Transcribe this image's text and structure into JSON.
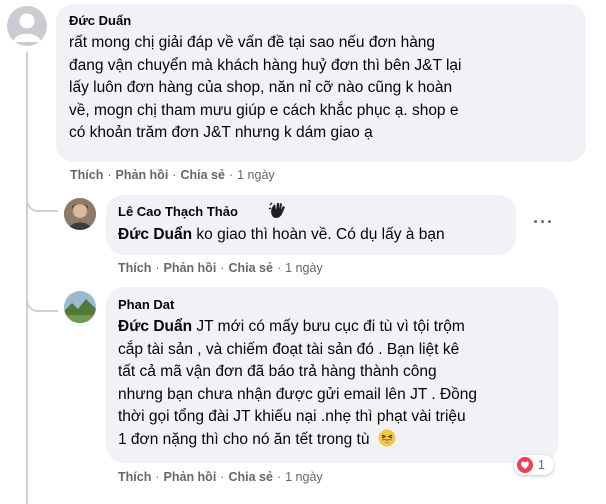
{
  "actions": {
    "like": "Thích",
    "reply": "Phản hồi",
    "share": "Chia sẻ",
    "separator": "·"
  },
  "comments": [
    {
      "author": "Đức Duẩn",
      "lines": [
        "rất mong chị giải đáp về vấn đề tại sao nếu đơn hàng",
        "đang vận chuyển mà khách hàng huỷ đơn thì bên J&T lại",
        "lấy luôn đơn hàng của shop, năn nỉ cỡ nào cũng k hoàn",
        "về, mogn chị tham mưu giúp e cách khắc phục ạ. shop e",
        "có khoản trăm đơn J&T nhưng k dám giao ạ"
      ],
      "time": "1 ngày"
    },
    {
      "author": "Lê Cao Thạch Thảo",
      "mention": "Đức Duẩn",
      "text": " ko giao thì hoàn về. Có dụ lấy à bạn",
      "time": "1 ngày"
    },
    {
      "author": "Phan Dat",
      "mention": "Đức Duẩn",
      "first_line": " JT mới có mấy bưu cục đi tù vì tội trộm",
      "lines": [
        "cắp tài sản , và chiếm đoạt tài sản đó . Bạn liệt kê",
        "tất cả mã vận đơn đã báo trả hàng thành công",
        "nhưng bạn chưa nhận được gửi email lên JT . Đồng",
        "thời gọi tổng đài JT khiếu nại .nhẹ thì phạt vài triệu",
        "1 đơn nặng thì cho nó ăn tết trong tù"
      ],
      "time": "1 ngày",
      "reaction_count": "1"
    }
  ],
  "icons": {
    "more": "more-options-icon",
    "reaction": "love-reaction-icon",
    "emoji": "grinning-squinting-emoji",
    "badge": "waving-hand-badge-icon"
  }
}
